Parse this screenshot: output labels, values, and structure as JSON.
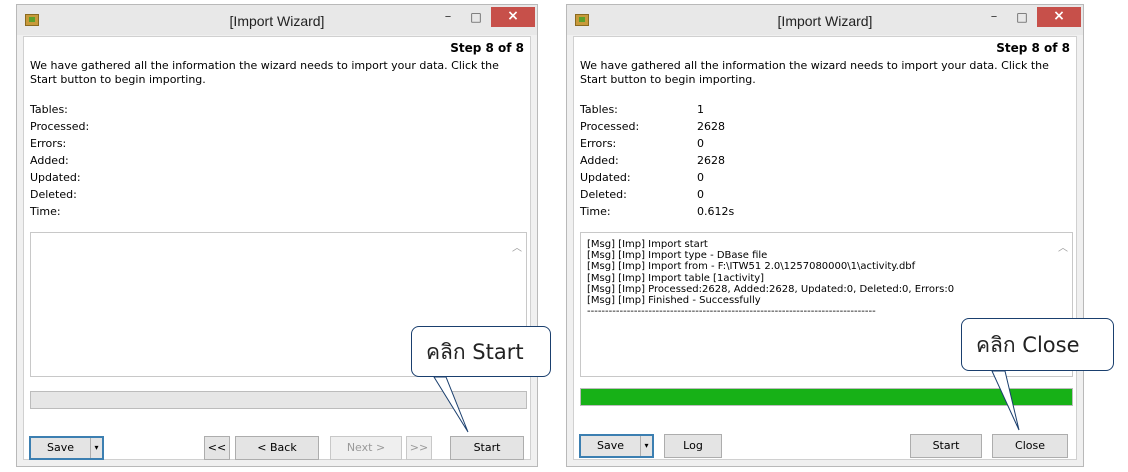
{
  "left_window": {
    "title": "[Import Wizard]",
    "controls": {
      "minimize": "–",
      "maximize": "□",
      "close": "×"
    },
    "step": "Step 8 of 8",
    "intro": "We have gathered all the information the wizard needs to import your data. Click the Start button to begin importing.",
    "stats": [
      {
        "label": "Tables:",
        "value": ""
      },
      {
        "label": "Processed:",
        "value": ""
      },
      {
        "label": "Errors:",
        "value": ""
      },
      {
        "label": "Added:",
        "value": ""
      },
      {
        "label": "Updated:",
        "value": ""
      },
      {
        "label": "Deleted:",
        "value": ""
      },
      {
        "label": "Time:",
        "value": ""
      }
    ],
    "log_text": "",
    "progress_fraction": 0,
    "buttons": {
      "save": "Save",
      "dropdown": "▾",
      "first": "<<",
      "back": "< Back",
      "next": "Next >",
      "last": ">>",
      "start": "Start"
    },
    "callout": "คลิก Start"
  },
  "right_window": {
    "title": "[Import Wizard]",
    "controls": {
      "minimize": "–",
      "maximize": "□",
      "close": "×"
    },
    "step": "Step 8 of 8",
    "intro": "We have gathered all the information the wizard needs to import your data. Click the Start button to begin importing.",
    "stats": [
      {
        "label": "Tables:",
        "value": "1"
      },
      {
        "label": "Processed:",
        "value": "2628"
      },
      {
        "label": "Errors:",
        "value": "0"
      },
      {
        "label": "Added:",
        "value": "2628"
      },
      {
        "label": "Updated:",
        "value": "0"
      },
      {
        "label": "Deleted:",
        "value": "0"
      },
      {
        "label": "Time:",
        "value": "0.612s"
      }
    ],
    "log_text": "[Msg] [Imp] Import start\n[Msg] [Imp] Import type - DBase file\n[Msg] [Imp] Import from - F:\\ITW51 2.0\\1257080000\\1\\activity.dbf\n[Msg] [Imp] Import table [1activity]\n[Msg] [Imp] Processed:2628, Added:2628, Updated:0, Deleted:0, Errors:0\n[Msg] [Imp] Finished - Successfully\n--------------------------------------------------------------------------------",
    "progress_fraction": 1,
    "buttons": {
      "save": "Save",
      "dropdown": "▾",
      "log": "Log",
      "start": "Start",
      "close": "Close"
    },
    "callout": "คลิก Close"
  },
  "colors": {
    "progress_fill": "#17b117",
    "close_button": "#c7504a",
    "callout_border": "#1a3f6e"
  },
  "icons": {
    "app": "import-wizard-icon",
    "scroll": "scroll-up-arrow-icon"
  }
}
